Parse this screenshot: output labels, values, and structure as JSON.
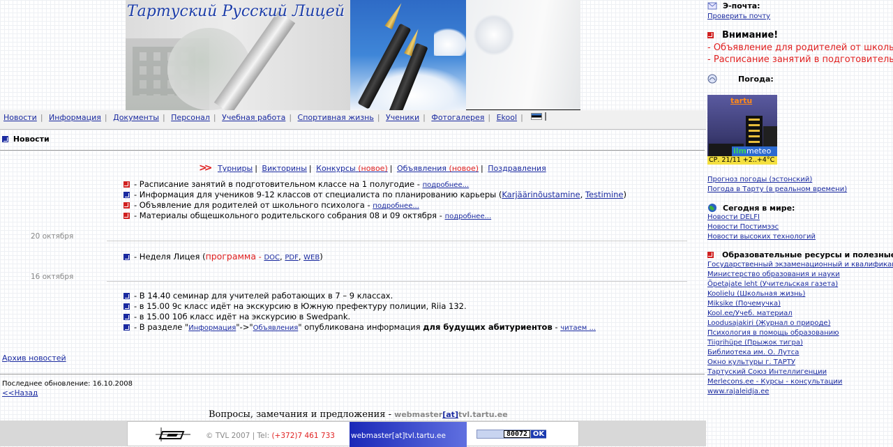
{
  "site_title": "Тартуский Русский Лицей",
  "nav": [
    {
      "label": "Новости"
    },
    {
      "label": "Информация"
    },
    {
      "label": "Документы"
    },
    {
      "label": "Персонал"
    },
    {
      "label": "Учебная работа"
    },
    {
      "label": "Спортивная жизнь"
    },
    {
      "label": "Ученики"
    },
    {
      "label": "Фотогалерея"
    },
    {
      "label": "Ekool"
    }
  ],
  "section_title": "Новости",
  "categories": {
    "tours": "Турниры",
    "quizzes": "Викторины",
    "contests": "Конкурсы",
    "contests_new": "(новое)",
    "announcements": "Объявления",
    "announcements_new": "(новое)",
    "greetings": "Поздравления"
  },
  "news_top": [
    {
      "text": "- Расписание занятий в подготовительном классе на 1 полугодие - ",
      "more": "подробнее..."
    },
    {
      "text": "- Информация для учеников 9-12 классов от специалиста по планированию карьеры (",
      "link1": "Karjäärinõustamine",
      "sep": ", ",
      "link2": "Testimine",
      "end": ")"
    },
    {
      "text": "- Объявление для родителей от школьного психолога - ",
      "more": "подробнее..."
    },
    {
      "text": "- Материалы общешкольного родительского собрания 08 и 09 октября - ",
      "more": "подробнее..."
    }
  ],
  "date1": "20 октября",
  "news_20": {
    "text": "- Неделя Лицея (",
    "program": "программа",
    "dash": " - ",
    "doc": "DOC",
    "pdf": "PDF",
    "web": "WEB",
    "end": ")"
  },
  "date2": "16 октября",
  "news_16": [
    {
      "text": "- В 14.40 семинар для учителей работающих в 7 – 9 классах."
    },
    {
      "text": "- в 15.00 9с класс идёт на экскурсию в Южную префектуру полиции, Riia 132."
    },
    {
      "text": "- в 15.00 10б класс идёт на экскурсию в Swedpank."
    }
  ],
  "news_16_last": {
    "pre": "- В разделе \"",
    "l1": "Информация",
    "mid": "\"->\"",
    "l2": "Объявления",
    "post": "\" опубликована информация ",
    "bold": "для будущих абитуриентов",
    "dash": " - ",
    "more": "читаем ..."
  },
  "archive": "Архив новостей",
  "updated": "Последнее обновление: 16.10.2008",
  "back": "<<Назад",
  "questions": {
    "text": "Вопросы, замечания и предложения - ",
    "email_a": "webmaster",
    "at": "[at]",
    "email_b": "tvl.tartu.ee"
  },
  "footer": {
    "copy": "© TVL 2007 | Tel: ",
    "phone": "(+372)7 461 733",
    "mail": "webmaster[at]tvl.tartu.ee",
    "counter": "80072",
    "ok": "OK"
  },
  "sidebar": {
    "email_head": "Э-почта:",
    "check_mail": "Проверить почту",
    "attention_head": "Внимание!",
    "attention": [
      "- Объявление для родителей от школьного психолога",
      "- Расписание занятий в подготовительном классе"
    ],
    "weather_head": "Погода:",
    "weather_logo": "tartu",
    "weather_meteo_a": "ilm",
    "weather_meteo_b": "meteo",
    "weather_temp": "СР. 21/11 +2..+4°C",
    "weather_links": [
      "Прогноз погоды (эстонский)",
      "Погода в Тарту (в реальном времени)"
    ],
    "world_head": "Сегодня в мире:",
    "world_links": [
      "Новости DELFI",
      "Новости Постимээс",
      "Новости высоких технологий"
    ],
    "edu_head": "Образовательные ресурсы и полезные ссылки",
    "edu_links": [
      "Государственный экзаменационный и квалификационный центр",
      "Министерство образования и науки",
      "Õpetajate leht (Учительская газета)",
      "Koolielu (Школьная жизнь)",
      "Miksike (Почемучка)",
      "Kool.ee/Учеб. материал",
      "Loodusajakiri (Журнал о природе)",
      "Психология в помощь образованию",
      "Tiigrihüpe (Прыжок тигра)",
      "Библиотека им. О. Лутса",
      "Окно культуры г. ТАРТУ",
      "Тартуский Союз Интеллигенции",
      "Merlecons.ee - Курсы - консультации",
      "www.rajaleidja.ee"
    ]
  },
  "colors": {
    "link": "#1a2aa0",
    "accent_red": "#e02020",
    "nav_bg": "#f0f0f0"
  }
}
